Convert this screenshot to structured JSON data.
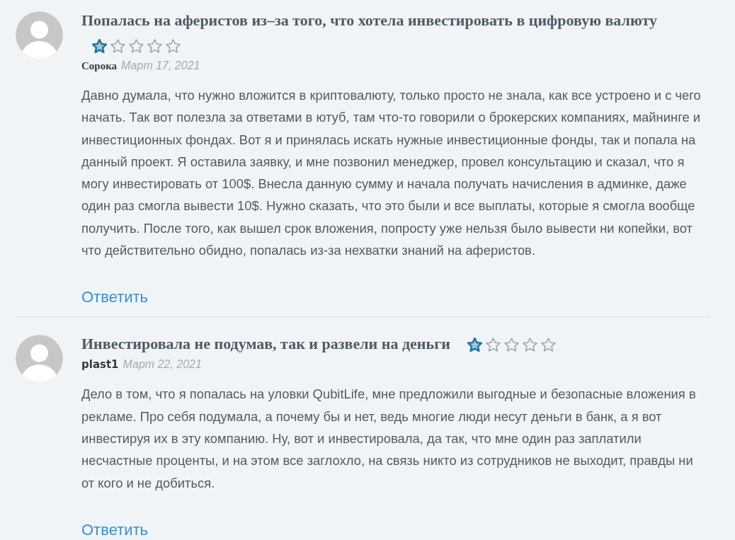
{
  "comments": [
    {
      "kind": "stacked",
      "title": "Попалась на аферистов из‒за того, что хотела инвестировать в цифровую валюту",
      "stars": 1,
      "author": "Сорока",
      "date": "Март 17, 2021",
      "body": "Давно думала, что нужно вложится в криптовалюту, только просто не знала, как все устроено и с чего начать. Так вот полезла за ответами в ютуб, там что-то говорили о брокерских компаниях, майнинге и инвестиционных фондах. Вот я и принялась искать нужные инвестиционные фонды, так и попала на данный проект. Я оставила заявку, и мне позвонил менеджер, провел консультацию и сказал, что я могу инвестировать от 100$. Внесла данную сумму и начала получать начисления в админке, даже один раз смогла вывести 10$. Нужно сказать, что это были и все выплаты, которые я смогла вообще получить. После того, как вышел срок вложения, попросту уже нельзя было вывести ни копейки, вот что действительно обидно, попалась из-за нехватки знаний на аферистов.",
      "reply": "Ответить"
    },
    {
      "kind": "inline",
      "title": "Инвестировала не подумав, так и развели на деньги",
      "stars": 1,
      "author": "plast1",
      "date": "Март 22, 2021",
      "body": "Дело в том, что я попалась на уловки QubitLife, мне предложили выгодные и безопасные вложения в рекламе. Про себя подумала, а почему бы и нет, ведь многие люди несут деньги в банк, а я вот инвестируя их в эту компанию. Ну, вот и инвестировала, да так, что мне один раз заплатили несчастные проценты, и на этом все заглохло, на связь никто из сотрудников не выходит, правды ни от кого и не добиться.",
      "reply": "Ответить"
    }
  ]
}
